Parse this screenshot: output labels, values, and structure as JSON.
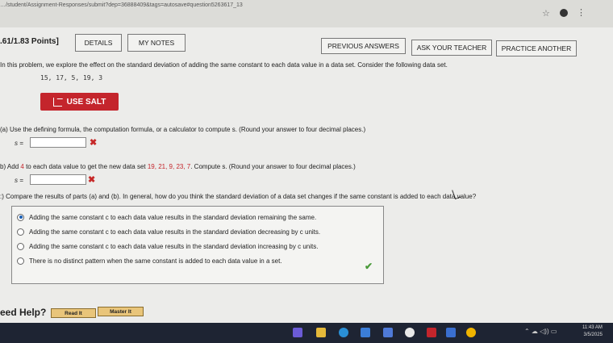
{
  "browser": {
    "url": "…/student/Assignment-Responses/submit?dep=36888409&tags=autosave#question5263617_13",
    "star_icon": "star-icon",
    "profile_icon": "profile-avatar",
    "menu_icon": "kebab-menu-icon"
  },
  "header": {
    "points": ".61/1.83 Points]",
    "details_label": "DETAILS",
    "notes_label": "MY NOTES",
    "previous_label": "PREVIOUS ANSWERS",
    "ask_label": "ASK YOUR TEACHER",
    "practice_label": "PRACTICE ANOTHER"
  },
  "problem": {
    "intro": "In this problem, we explore the effect on the standard deviation of adding the same constant to each data value in a data set. Consider the following data set.",
    "dataset": "15, 17, 5, 19, 3",
    "salt_label": "USE SALT",
    "part_a": {
      "prefix": "(a)",
      "text": "Use the defining formula, the computation formula, or a calculator to compute s. (Round your answer to four decimal places.)",
      "s_label": "s ="
    },
    "part_b": {
      "prefix": "b)",
      "text_1": "Add",
      "constant": "4",
      "text_2": "to each data value to get the new data set",
      "new_set": "19, 21, 9, 23, 7",
      "text_3": ". Compute s. (Round your answer to four decimal places.)",
      "s_label": "s ="
    },
    "part_c": {
      "prefix": ":)",
      "text": "Compare the results of parts (a) and (b). In general, how do you think the standard deviation of a data set changes if the same constant is added to each data value?",
      "choices": [
        "Adding the same constant c to each data value results in the standard deviation remaining the same.",
        "Adding the same constant c to each data value results in the standard deviation decreasing by c units.",
        "Adding the same constant c to each data value results in the standard deviation increasing by c units.",
        "There is no distinct pattern when the same constant is added to each data value in a set."
      ],
      "selected_index": 0
    }
  },
  "help": {
    "label": "eed Help?",
    "read_label": "Read It",
    "master_label": "Master It"
  },
  "taskbar": {
    "time": "11:43 AM",
    "date": "3/5/2025"
  },
  "colors": {
    "accent_red": "#c4252c",
    "wrong_red": "#c62828",
    "correct_green": "#4a9a3a"
  }
}
